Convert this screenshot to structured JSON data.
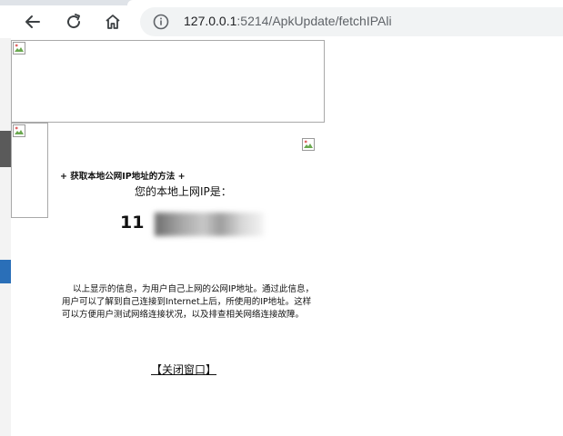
{
  "browser": {
    "url_host": "127.0.0.1",
    "url_rest": ":5214/ApkUpdate/fetchIPAli",
    "back_icon": "arrow-left-icon",
    "reload_icon": "reload-icon",
    "home_icon": "home-icon",
    "info_icon": "info-icon"
  },
  "page": {
    "method_title": "+ 获取本地公网IP地址的方法 +",
    "ip_label": "您的本地上网IP是：",
    "ip_value_visible": "11",
    "description": "以上显示的信息，为用户自己上网的公网IP地址。通过此信息，用户可以了解到自己连接到Internet上后，所使用的IP地址。这样可以方便用户测试网络连接状况，以及排查相关网络连接故障。",
    "close_link": "【关闭窗口】"
  }
}
